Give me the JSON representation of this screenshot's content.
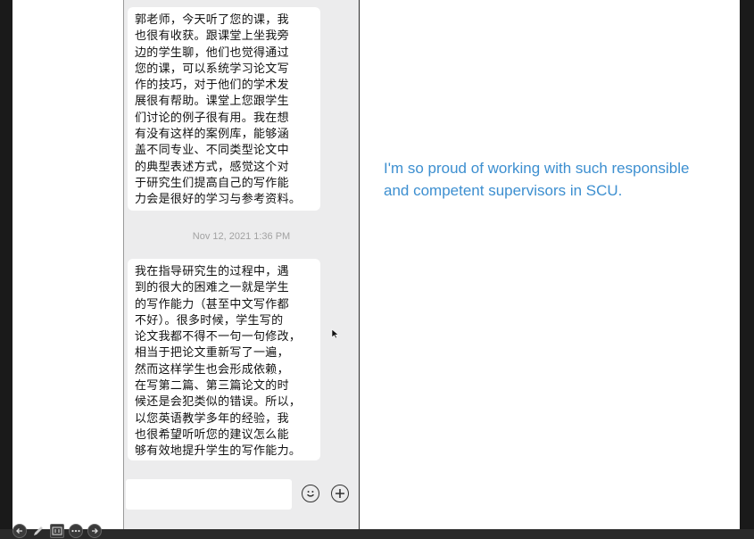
{
  "chat": {
    "messages": [
      {
        "text": "郭老师，今天听了您的课，我\n也很有收获。跟课堂上坐我旁\n边的学生聊，他们也觉得通过\n您的课，可以系统学习论文写\n作的技巧，对于他们的学术发\n展很有帮助。课堂上您跟学生\n们讨论的例子很有用。我在想\n有没有这样的案例库，能够涵\n盖不同专业、不同类型论文中\n的典型表述方式，感觉这个对\n于研究生们提高自己的写作能\n力会是很好的学习与参考资料。"
      },
      {
        "text": "我在指导研究生的过程中，遇\n到的很大的困难之一就是学生\n的写作能力（甚至中文写作都\n不好）。很多时候，学生写的\n论文我都不得不一句一句修改，\n相当于把论文重新写了一遍，\n然而这样学生也会形成依赖，\n在写第二篇、第三篇论文的时\n候还是会犯类似的错误。所以，\n以您英语教学多年的经验，我\n也很希望听听您的建议怎么能\n够有效地提升学生的写作能力。"
      }
    ],
    "timestamp": "Nov 12, 2021 1:36 PM",
    "input_value": ""
  },
  "slide": {
    "caption": "I'm so proud of working with such responsible\nand competent supervisors in SCU."
  },
  "icons": {
    "emoji": "smiley-icon",
    "add": "plus-icon",
    "controls": [
      "prev-icon",
      "pen-icon",
      "captions-icon",
      "more-icon",
      "next-icon"
    ]
  },
  "colors": {
    "accent": "#3d8fd0",
    "chat_background": "#ececed",
    "bubble": "#ffffff",
    "timestamp": "#a2a2a2"
  }
}
